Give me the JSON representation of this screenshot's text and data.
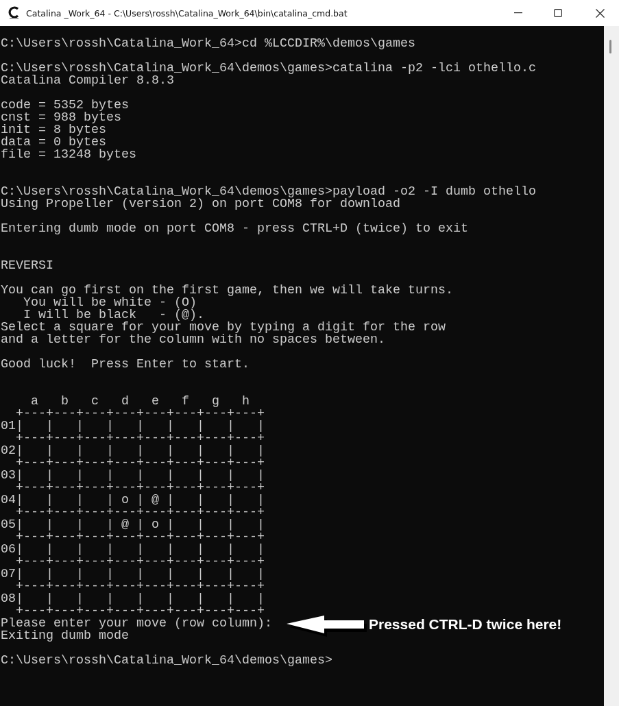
{
  "window": {
    "title": "Catalina _Work_64 - C:\\Users\\rossh\\Catalina_Work_64\\bin\\catalina_cmd.bat"
  },
  "terminal": {
    "lines": [
      {
        "kind": "text",
        "text": "C:\\Users\\rossh\\Catalina_Work_64>cd %LCCDIR%\\demos\\games"
      },
      {
        "kind": "blank"
      },
      {
        "kind": "text",
        "text": "C:\\Users\\rossh\\Catalina_Work_64\\demos\\games>catalina -p2 -lci othello.c"
      },
      {
        "kind": "text",
        "text": "Catalina Compiler 8.8.3"
      },
      {
        "kind": "blank"
      },
      {
        "kind": "text",
        "text": "code = 5352 bytes"
      },
      {
        "kind": "text",
        "text": "cnst = 988 bytes"
      },
      {
        "kind": "text",
        "text": "init = 8 bytes"
      },
      {
        "kind": "text",
        "text": "data = 0 bytes"
      },
      {
        "kind": "text",
        "text": "file = 13248 bytes"
      },
      {
        "kind": "blank"
      },
      {
        "kind": "blank"
      },
      {
        "kind": "text",
        "text": "C:\\Users\\rossh\\Catalina_Work_64\\demos\\games>payload -o2 -I dumb othello"
      },
      {
        "kind": "text",
        "text": "Using Propeller (version 2) on port COM8 for download"
      },
      {
        "kind": "blank"
      },
      {
        "kind": "text",
        "text": "Entering dumb mode on port COM8 - press CTRL+D (twice) to exit"
      },
      {
        "kind": "blank"
      },
      {
        "kind": "blank"
      },
      {
        "kind": "text",
        "text": "REVERSI"
      },
      {
        "kind": "blank"
      },
      {
        "kind": "text",
        "text": "You can go first on the first game, then we will take turns."
      },
      {
        "kind": "text",
        "text": "   You will be white - (O)"
      },
      {
        "kind": "text",
        "text": "   I will be black   - (@)."
      },
      {
        "kind": "text",
        "text": "Select a square for your move by typing a digit for the row"
      },
      {
        "kind": "text",
        "text": "and a letter for the column with no spaces between."
      },
      {
        "kind": "blank"
      },
      {
        "kind": "text",
        "text": "Good luck!  Press Enter to start."
      },
      {
        "kind": "blank"
      },
      {
        "kind": "blank"
      },
      {
        "kind": "text",
        "text": "    a   b   c   d   e   f   g   h"
      },
      {
        "kind": "text",
        "text": "  +---+---+---+---+---+---+---+---+"
      },
      {
        "kind": "text",
        "text": "01|   |   |   |   |   |   |   |   |"
      },
      {
        "kind": "text",
        "text": "  +---+---+---+---+---+---+---+---+"
      },
      {
        "kind": "text",
        "text": "02|   |   |   |   |   |   |   |   |"
      },
      {
        "kind": "text",
        "text": "  +---+---+---+---+---+---+---+---+"
      },
      {
        "kind": "text",
        "text": "03|   |   |   |   |   |   |   |   |"
      },
      {
        "kind": "text",
        "text": "  +---+---+---+---+---+---+---+---+"
      },
      {
        "kind": "text",
        "text": "04|   |   |   | o | @ |   |   |   |"
      },
      {
        "kind": "text",
        "text": "  +---+---+---+---+---+---+---+---+"
      },
      {
        "kind": "text",
        "text": "05|   |   |   | @ | o |   |   |   |"
      },
      {
        "kind": "text",
        "text": "  +---+---+---+---+---+---+---+---+"
      },
      {
        "kind": "text",
        "text": "06|   |   |   |   |   |   |   |   |"
      },
      {
        "kind": "text",
        "text": "  +---+---+---+---+---+---+---+---+"
      },
      {
        "kind": "text",
        "text": "07|   |   |   |   |   |   |   |   |"
      },
      {
        "kind": "text",
        "text": "  +---+---+---+---+---+---+---+---+"
      },
      {
        "kind": "text",
        "text": "08|   |   |   |   |   |   |   |   |"
      },
      {
        "kind": "text",
        "text": "  +---+---+---+---+---+---+---+---+"
      },
      {
        "kind": "text",
        "text": "Please enter your move (row column):"
      },
      {
        "kind": "text",
        "text": "Exiting dumb mode"
      },
      {
        "kind": "blank"
      },
      {
        "kind": "text",
        "text": "C:\\Users\\rossh\\Catalina_Work_64\\demos\\games>"
      }
    ]
  },
  "annotation": {
    "text": "Pressed CTRL-D twice here!"
  }
}
